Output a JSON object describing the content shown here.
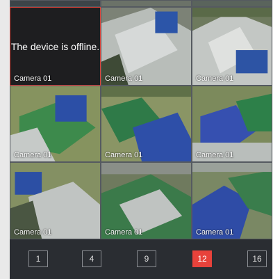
{
  "offline_message": "The device is offline.",
  "camera_label": "Camera 01",
  "pages": [
    "1",
    "4",
    "9",
    "12",
    "16"
  ],
  "active_page": "12",
  "colors": {
    "background": "#2a2d32",
    "active_page": "#e8423b",
    "offline_tile": "#1e1e20"
  }
}
